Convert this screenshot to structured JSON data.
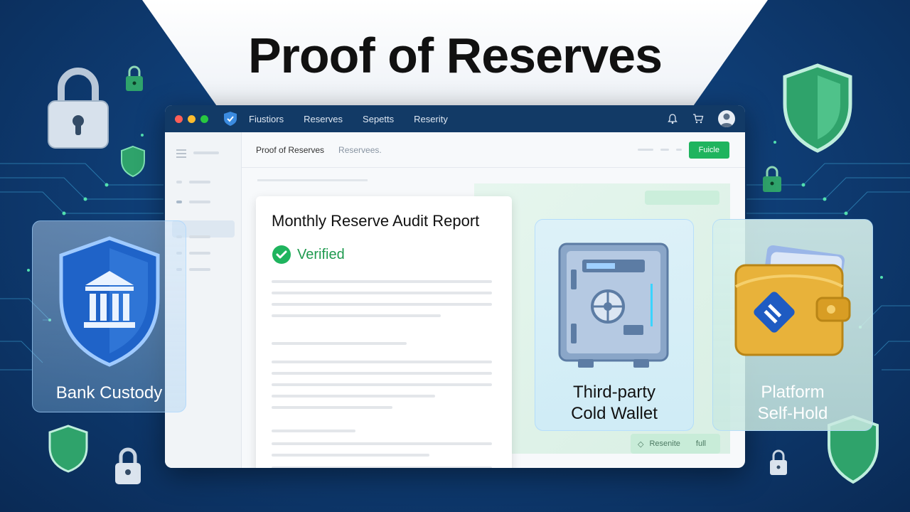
{
  "headline": "Proof of Reserves",
  "window": {
    "nav": [
      "Fiustiors",
      "Reserves",
      "Sepetts",
      "Reserity"
    ],
    "breadcrumb": {
      "current": "Proof of Reserves",
      "secondary": "Reservees."
    },
    "action_button": "Fuicle"
  },
  "report": {
    "title": "Monthly Reserve Audit Report",
    "status": "Verified",
    "reserve_button": "Resenite",
    "reserve_button_suffix": "full"
  },
  "custody": {
    "bank": "Bank Custody",
    "cold_wallet_line1": "Third-party",
    "cold_wallet_line2": "Cold Wallet",
    "self_hold_line1": "Platform",
    "self_hold_line2": "Self-Hold"
  },
  "colors": {
    "accent_green": "#1fb45e",
    "titlebar_navy": "#123a66",
    "shield_blue": "#1f63c8",
    "shield_green": "#2fa36b",
    "wallet_gold": "#e8b23a"
  },
  "icons": [
    "padlock-icon",
    "shield-icon",
    "bank-icon",
    "vault-icon",
    "wallet-icon",
    "bell-icon",
    "cart-icon",
    "user-avatar-icon",
    "check-circle-icon"
  ]
}
